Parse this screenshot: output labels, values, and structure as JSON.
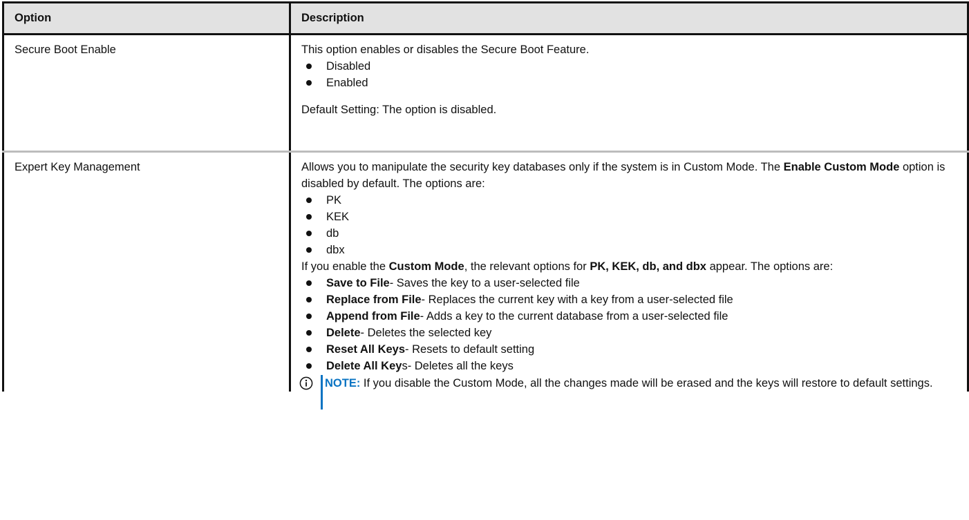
{
  "headers": {
    "option": "Option",
    "description": "Description"
  },
  "rows": [
    {
      "option": "Secure Boot Enable",
      "intro": "This option enables or disables the Secure Boot Feature.",
      "bullets": [
        "Disabled",
        "Enabled"
      ],
      "default": "Default Setting: The option is disabled."
    },
    {
      "option": "Expert Key Management",
      "intro_a": "Allows you to manipulate the security key databases only if the system is in Custom Mode. The ",
      "intro_b": "Enable Custom Mode",
      "intro_c": " option is disabled by default. The options are:",
      "key_bullets": [
        "PK",
        "KEK",
        "db",
        "dbx"
      ],
      "custom_a": "If you enable the ",
      "custom_b": "Custom Mode",
      "custom_c": ", the relevant options for ",
      "custom_d": "PK, KEK, db, and dbx",
      "custom_e": " appear. The options are:",
      "actions": [
        {
          "label": "Save to File",
          "rest": "- Saves the key to a user-selected file"
        },
        {
          "label": "Replace from File",
          "rest": "- Replaces the current key with a key from a user-selected file"
        },
        {
          "label": "Append from File",
          "rest": "- Adds a key to the current database from a user-selected file"
        },
        {
          "label": "Delete",
          "rest": "- Deletes the selected key"
        },
        {
          "label": "Reset All Keys",
          "rest": "- Resets to default setting"
        },
        {
          "label": "Delete All Key",
          "rest": "s- Deletes all the keys"
        }
      ],
      "note_label": "NOTE:",
      "note_text": " If you disable the Custom Mode, all the changes made will be erased and the keys will restore to default settings."
    }
  ],
  "colors": {
    "note_accent": "#0a74c3",
    "header_bg": "#e2e2e2",
    "row_divider": "#bcbcbc"
  },
  "icons": {
    "note": "info-circle-icon"
  }
}
